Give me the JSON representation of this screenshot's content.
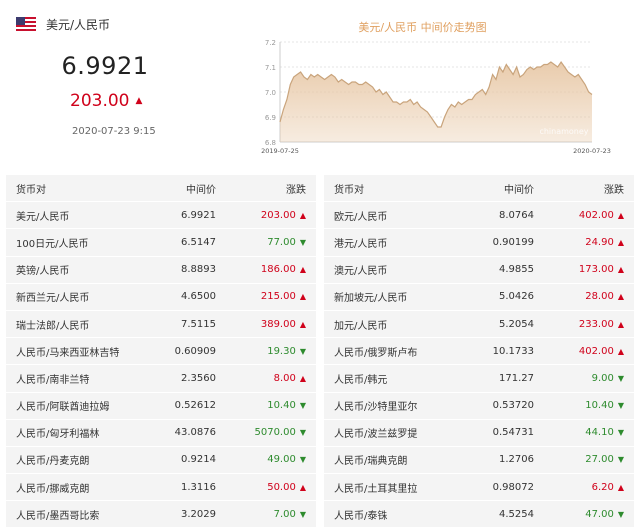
{
  "header": {
    "pair": "美元/人民币",
    "rate": "6.9921",
    "change": "203.00",
    "time": "2020-07-23 9:15"
  },
  "trend_chart": {
    "title": "美元/人民币 中间价走势图",
    "y_ticks": [
      "7.2",
      "7.1",
      "7.0",
      "6.9",
      "6.8"
    ],
    "x_start": "2019-07-25",
    "x_end": "2020-07-23",
    "watermark": "chinamoney",
    "fill_color": "#e8c9a8",
    "line_color": "#c9a47c",
    "values": [
      6.88,
      6.93,
      6.97,
      7.03,
      7.06,
      7.07,
      7.08,
      7.06,
      7.05,
      7.07,
      7.06,
      7.07,
      7.06,
      7.05,
      7.06,
      7.07,
      7.06,
      7.04,
      7.05,
      7.04,
      7.03,
      7.04,
      7.04,
      7.03,
      7.03,
      7.04,
      7.03,
      7.02,
      7.0,
      7.01,
      6.99,
      7.0,
      6.98,
      6.96,
      6.96,
      6.95,
      6.96,
      6.96,
      6.97,
      6.95,
      6.96,
      6.94,
      6.93,
      6.92,
      6.9,
      6.88,
      6.86,
      6.86,
      6.9,
      6.93,
      6.95,
      6.94,
      6.96,
      6.95,
      6.96,
      6.97,
      6.97,
      6.99,
      7.0,
      7.01,
      6.99,
      7.02,
      7.07,
      7.05,
      7.1,
      7.08,
      7.11,
      7.09,
      7.07,
      7.1,
      7.06,
      7.07,
      7.09,
      7.1,
      7.09,
      7.1,
      7.1,
      7.11,
      7.11,
      7.12,
      7.11,
      7.1,
      7.12,
      7.1,
      7.08,
      7.07,
      7.06,
      7.07,
      7.05,
      7.03,
      7.0,
      6.99
    ]
  },
  "colors": {
    "up": "#d0021b",
    "down": "#2e8b2e",
    "row_bg": "#f4f4f4"
  },
  "table_headers": {
    "pair": "货币对",
    "mid": "中间价",
    "change": "涨跌"
  },
  "left_rows": [
    {
      "pair": "美元/人民币",
      "mid": "6.9921",
      "change": "203.00",
      "dir": "up"
    },
    {
      "pair": "100日元/人民币",
      "mid": "6.5147",
      "change": "77.00",
      "dir": "down"
    },
    {
      "pair": "英镑/人民币",
      "mid": "8.8893",
      "change": "186.00",
      "dir": "up"
    },
    {
      "pair": "新西兰元/人民币",
      "mid": "4.6500",
      "change": "215.00",
      "dir": "up"
    },
    {
      "pair": "瑞士法郎/人民币",
      "mid": "7.5115",
      "change": "389.00",
      "dir": "up"
    },
    {
      "pair": "人民币/马来西亚林吉特",
      "mid": "0.60909",
      "change": "19.30",
      "dir": "down"
    },
    {
      "pair": "人民币/南非兰特",
      "mid": "2.3560",
      "change": "8.00",
      "dir": "up"
    },
    {
      "pair": "人民币/阿联酋迪拉姆",
      "mid": "0.52612",
      "change": "10.40",
      "dir": "down"
    },
    {
      "pair": "人民币/匈牙利福林",
      "mid": "43.0876",
      "change": "5070.00",
      "dir": "down"
    },
    {
      "pair": "人民币/丹麦克朗",
      "mid": "0.9214",
      "change": "49.00",
      "dir": "down"
    },
    {
      "pair": "人民币/挪威克朗",
      "mid": "1.3116",
      "change": "50.00",
      "dir": "up"
    },
    {
      "pair": "人民币/墨西哥比索",
      "mid": "3.2029",
      "change": "7.00",
      "dir": "down"
    }
  ],
  "right_rows": [
    {
      "pair": "欧元/人民币",
      "mid": "8.0764",
      "change": "402.00",
      "dir": "up"
    },
    {
      "pair": "港元/人民币",
      "mid": "0.90199",
      "change": "24.90",
      "dir": "up"
    },
    {
      "pair": "澳元/人民币",
      "mid": "4.9855",
      "change": "173.00",
      "dir": "up"
    },
    {
      "pair": "新加坡元/人民币",
      "mid": "5.0426",
      "change": "28.00",
      "dir": "up"
    },
    {
      "pair": "加元/人民币",
      "mid": "5.2054",
      "change": "233.00",
      "dir": "up"
    },
    {
      "pair": "人民币/俄罗斯卢布",
      "mid": "10.1733",
      "change": "402.00",
      "dir": "up"
    },
    {
      "pair": "人民币/韩元",
      "mid": "171.27",
      "change": "9.00",
      "dir": "down"
    },
    {
      "pair": "人民币/沙特里亚尔",
      "mid": "0.53720",
      "change": "10.40",
      "dir": "down"
    },
    {
      "pair": "人民币/波兰兹罗提",
      "mid": "0.54731",
      "change": "44.10",
      "dir": "down"
    },
    {
      "pair": "人民币/瑞典克朗",
      "mid": "1.2706",
      "change": "27.00",
      "dir": "down"
    },
    {
      "pair": "人民币/土耳其里拉",
      "mid": "0.98072",
      "change": "6.20",
      "dir": "up"
    },
    {
      "pair": "人民币/泰铢",
      "mid": "4.5254",
      "change": "47.00",
      "dir": "down"
    }
  ]
}
